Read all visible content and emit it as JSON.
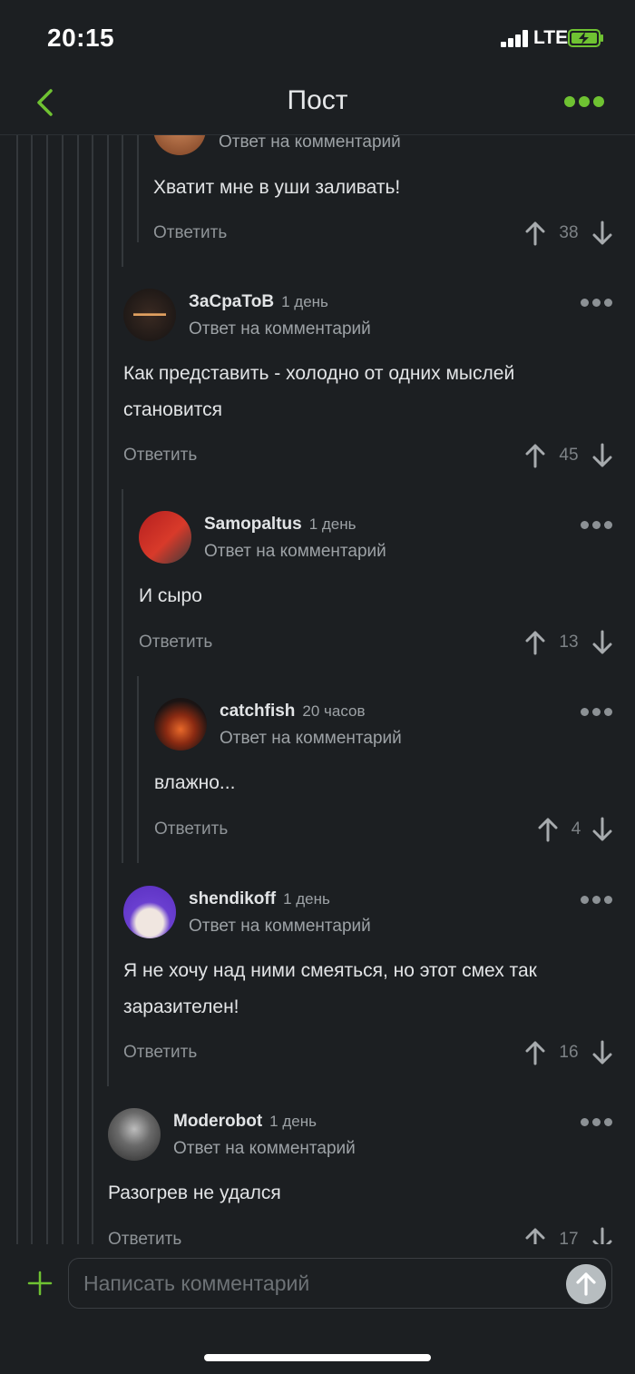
{
  "status": {
    "time": "20:15",
    "network": "LTE"
  },
  "nav": {
    "title": "Пост",
    "back_icon": "chevron-left-icon",
    "more_icon": "more-dots-icon",
    "accent": "#6fc232"
  },
  "comments": [
    {
      "reply_label": "Ответ на комментарий",
      "text": "Хватит мне в уши заливать!",
      "reply": "Ответить",
      "score": "38"
    },
    {
      "author": "ЗаСраТоВ",
      "ago": "1 день",
      "reply_label": "Ответ на комментарий",
      "text1": "Как представить - холодно от одних мыслей",
      "text2": "становится",
      "reply": "Ответить",
      "score": "45"
    },
    {
      "author": "Samopaltus",
      "ago": "1 день",
      "reply_label": "Ответ на комментарий",
      "text": "И сыро",
      "reply": "Ответить",
      "score": "13"
    },
    {
      "author": "catchfish",
      "ago": "20 часов",
      "reply_label": "Ответ на комментарий",
      "text": "влажно...",
      "reply": "Ответить",
      "score": "4"
    },
    {
      "author": "shendikoff",
      "ago": "1 день",
      "reply_label": "Ответ на комментарий",
      "text1": "Я не хочу над ними смеяться, но этот смех так",
      "text2": "заразителен!",
      "reply": "Ответить",
      "score": "16"
    },
    {
      "author": "Moderobot",
      "ago": "1 день",
      "reply_label": "Ответ на комментарий",
      "text": "Разогрев не удался",
      "reply": "Ответить",
      "score": "17"
    }
  ],
  "composer": {
    "placeholder": "Написать комментарий",
    "plus_icon": "plus-icon",
    "send_icon": "send-arrow-icon"
  }
}
